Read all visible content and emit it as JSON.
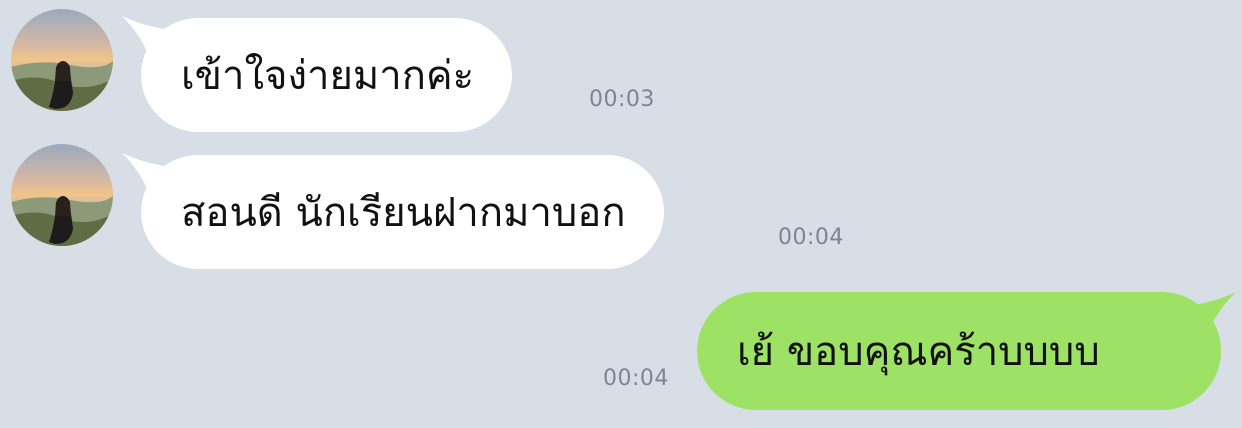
{
  "messages": [
    {
      "direction": "incoming",
      "text": "เข้าใจง่ายมากค่ะ",
      "time": "00:03"
    },
    {
      "direction": "incoming",
      "text": "สอนดี นักเรียนฝากมาบอก",
      "time": "00:04"
    },
    {
      "direction": "outgoing",
      "text": "เย้ ขอบคุณคร้าบบบบ",
      "time": "00:04"
    }
  ],
  "colors": {
    "background": "#d8dee6",
    "incoming_bubble": "#ffffff",
    "outgoing_bubble": "#9de264",
    "timestamp": "#7b8594"
  },
  "icons": {
    "avatar": "sender-avatar"
  }
}
